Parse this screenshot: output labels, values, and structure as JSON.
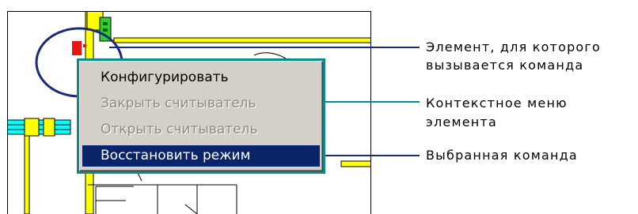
{
  "context_menu": {
    "items": [
      {
        "label": "Конфигурировать",
        "state": "enabled"
      },
      {
        "label": "Закрыть считыватель",
        "state": "disabled"
      },
      {
        "label": "Открыть считыватель",
        "state": "disabled"
      },
      {
        "label": "Восстановить режим",
        "state": "selected"
      }
    ]
  },
  "callouts": {
    "element": [
      "Элемент, для которого",
      "вызывается команда"
    ],
    "context_menu": [
      "Контекстное меню",
      "элемента"
    ],
    "selected_command": [
      "Выбранная команда"
    ]
  },
  "colors": {
    "callout_line": "#1a2a7a",
    "menu_frame": "#0a8a8a",
    "highlight": "#0a246a",
    "wall_fill": "#ffff00",
    "reader_green": "#33cc33",
    "alarm_red": "#ee1111",
    "corridor_cyan": "#00ffff"
  }
}
